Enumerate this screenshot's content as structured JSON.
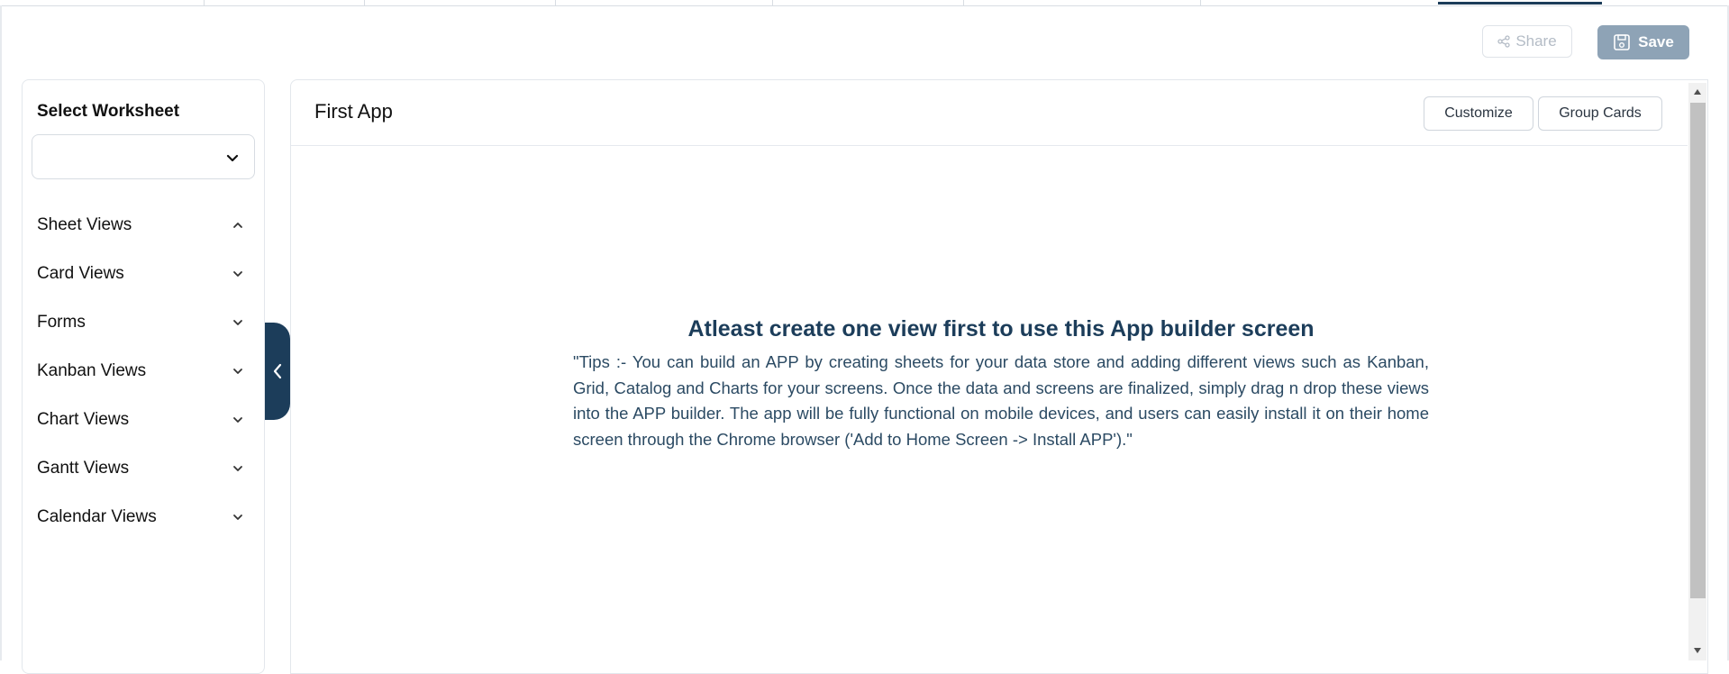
{
  "toolbar": {
    "share_label": "Share",
    "save_label": "Save"
  },
  "sidebar": {
    "select_title": "Select Worksheet",
    "select_value": "",
    "items": [
      {
        "label": "Sheet Views",
        "state": "expanded"
      },
      {
        "label": "Card Views",
        "state": "collapsed"
      },
      {
        "label": "Forms",
        "state": "collapsed"
      },
      {
        "label": "Kanban Views",
        "state": "collapsed"
      },
      {
        "label": "Chart Views",
        "state": "collapsed"
      },
      {
        "label": "Gantt Views",
        "state": "collapsed"
      },
      {
        "label": "Calendar Views",
        "state": "collapsed"
      }
    ]
  },
  "main": {
    "title": "First App",
    "customize_label": "Customize",
    "group_cards_label": "Group Cards",
    "empty_title": "Atleast create one view first to use this App builder screen",
    "empty_tip": "\"Tips :- You can build an APP by creating sheets for your data store and adding different views such as Kanban, Grid, Catalog and Charts for your screens. Once the data and screens are finalized, simply drag n drop these views into the APP builder. The app will be fully functional on mobile devices, and users can easily install it on their home screen through the Chrome browser ('Add to Home Screen -> Install APP').\""
  },
  "colors": {
    "primary": "#1c3d5a",
    "save_button": "#8ea3b6",
    "border": "#e3e7ec"
  }
}
